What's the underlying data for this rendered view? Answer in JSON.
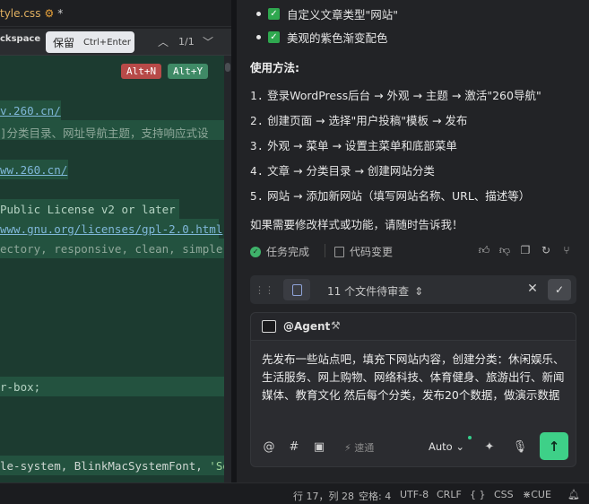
{
  "editor": {
    "tab": {
      "filename": "tyle.css",
      "modified_marker": "*"
    },
    "findbar": {
      "backspace_label": "ckspace",
      "keep_label": "保留",
      "keep_shortcut": "Ctrl+Enter",
      "match_count": "1/1"
    },
    "badges": {
      "reject": "Alt+N",
      "accept": "Alt+Y"
    },
    "lines": {
      "l1": "v.260.cn/",
      "l2": "]分类目录、网址导航主题，支持响应式设",
      "l3": "ww.260.cn/",
      "l4": "Public License v2 or later",
      "l5": "www.gnu.org/licenses/gpl-2.0.html",
      "l6": "ectory, responsive, clean, simple",
      "l7": "r-box;",
      "l8_code": "le-system, BlinkMacSystemFont, ",
      "l8_str": "'Se"
    }
  },
  "panel": {
    "features": [
      {
        "label": "自定义文章类型\"网站\""
      },
      {
        "label": "美观的紫色渐变配色"
      }
    ],
    "usage_title": "使用方法:",
    "steps": [
      {
        "num": "1.",
        "text": "登录WordPress后台 → 外观 → 主题 → 激活\"260导航\""
      },
      {
        "num": "2.",
        "text": "创建页面 → 选择\"用户投稿\"模板 → 发布"
      },
      {
        "num": "3.",
        "text": "外观 → 菜单 → 设置主菜单和底部菜单"
      },
      {
        "num": "4.",
        "text": "文章 → 分类目录 → 创建网站分类"
      },
      {
        "num": "5.",
        "text": "网站 → 添加新网站（填写网站名称、URL、描述等）"
      }
    ],
    "closing": "如果需要修改样式或功能，请随时告诉我！",
    "status": {
      "done_label": "任务完成",
      "diff_label": "代码变更"
    },
    "review": {
      "text": "11 个文件待审查"
    },
    "composer": {
      "agent_label": "@Agent",
      "message": "先发布一些站点吧，填充下网站内容，创建分类：休闲娱乐、生活服务、网上购物、网络科技、体育健身、旅游出行、新闻媒体、教育文化 然后每个分类，发布20个数据，做演示数据",
      "speed_label": "速通",
      "mode_label": "Auto"
    }
  },
  "statusbar": {
    "position": "行 17，列 28",
    "indent": "空格: 4",
    "encoding": "UTF-8",
    "eol": "CRLF",
    "braces": "{ }",
    "language": "CSS",
    "cue": "CUE"
  },
  "colors": {
    "accent_green": "#3ed088",
    "code_bg": "#1c3b30"
  }
}
